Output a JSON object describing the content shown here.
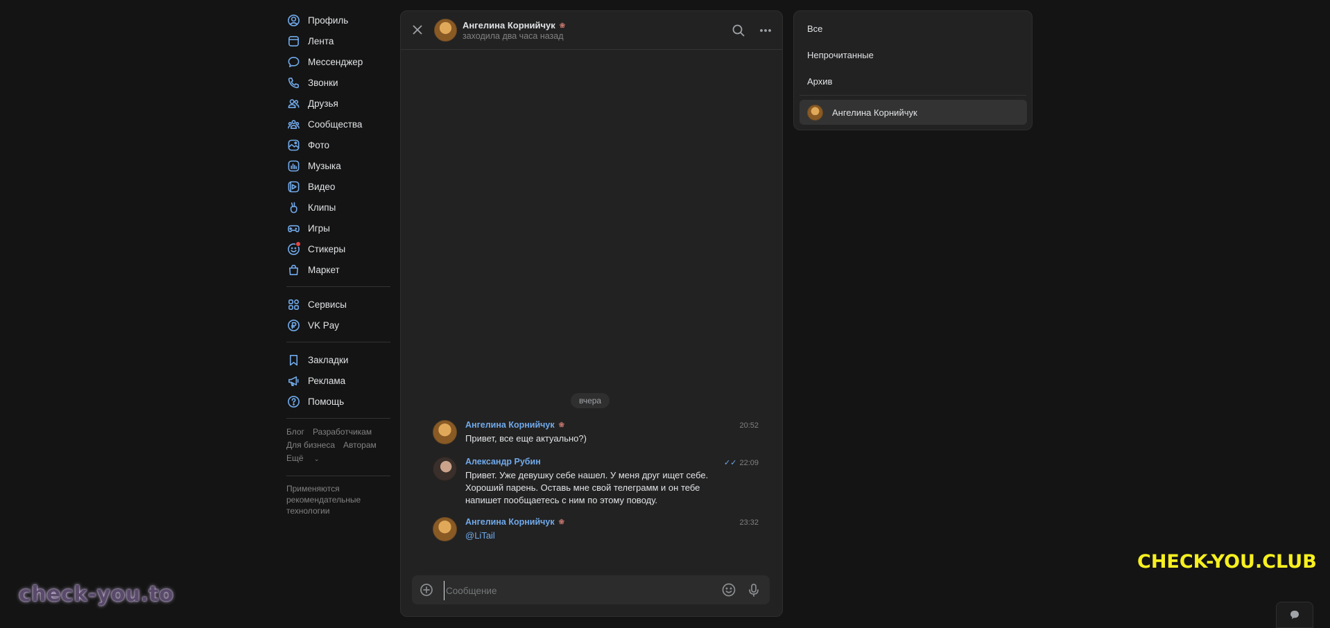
{
  "nav": {
    "main": [
      {
        "label": "Профиль",
        "icon": "user-circle-icon"
      },
      {
        "label": "Лента",
        "icon": "newsfeed-icon"
      },
      {
        "label": "Мессенджер",
        "icon": "message-icon"
      },
      {
        "label": "Звонки",
        "icon": "phone-icon"
      },
      {
        "label": "Друзья",
        "icon": "friends-icon"
      },
      {
        "label": "Сообщества",
        "icon": "communities-icon"
      },
      {
        "label": "Фото",
        "icon": "photo-icon"
      },
      {
        "label": "Музыка",
        "icon": "music-icon"
      },
      {
        "label": "Видео",
        "icon": "video-icon"
      },
      {
        "label": "Клипы",
        "icon": "clips-icon"
      },
      {
        "label": "Игры",
        "icon": "gamepad-icon"
      },
      {
        "label": "Стикеры",
        "icon": "sticker-icon"
      },
      {
        "label": "Маркет",
        "icon": "market-bag-icon"
      }
    ],
    "services": [
      {
        "label": "Сервисы",
        "icon": "services-grid-icon"
      },
      {
        "label": "VK Pay",
        "icon": "vk-pay-icon"
      }
    ],
    "extra": [
      {
        "label": "Закладки",
        "icon": "bookmark-icon"
      },
      {
        "label": "Реклама",
        "icon": "megaphone-icon"
      },
      {
        "label": "Помощь",
        "icon": "help-icon"
      }
    ],
    "footer_links": {
      "blog": "Блог",
      "developers": "Разработчикам",
      "business": "Для бизнеса",
      "authors": "Авторам",
      "more": "Ещё"
    },
    "footer_note": "Применяются рекомендательные технологии"
  },
  "chat": {
    "header": {
      "name": "Ангелина Корнийчук",
      "status": "заходила два часа назад"
    },
    "date_divider": "вчера",
    "messages": [
      {
        "author": "Ангелина Корнийчук",
        "time": "20:52",
        "text": "Привет, все еще актуально?)"
      },
      {
        "author": "Александр Рубин",
        "time": "22:09",
        "text": "Привет. Уже девушку себе нашел. У меня друг ищет себе. Хороший парень. Оставь мне свой телеграмм и он тебе напишет пообщаетесь с ним по этому поводу."
      },
      {
        "author": "Ангелина Корнийчук",
        "time": "23:32",
        "text": "@LiTail"
      }
    ],
    "composer": {
      "placeholder": "Сообщение"
    }
  },
  "filters": {
    "all": "Все",
    "unread": "Непрочитанные",
    "archive": "Архив",
    "conversation": "Ангелина Корнийчук"
  },
  "watermarks": {
    "left": "check-you.to",
    "right": "CHECK-YOU.CLUB"
  },
  "colors": {
    "accent": "#71aaeb",
    "background": "#141414",
    "panel": "#222222",
    "watermark_yellow": "#f7f01f"
  }
}
